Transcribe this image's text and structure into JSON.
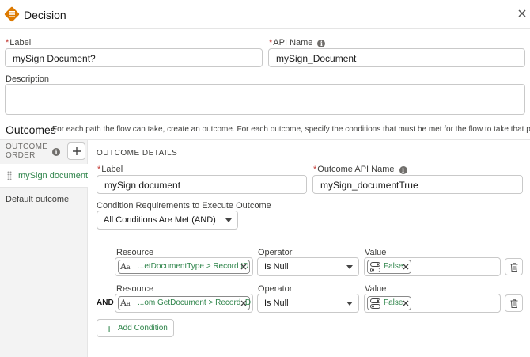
{
  "header": {
    "title": "Decision",
    "logo_icon": "decision-diamond-icon",
    "accent": "#dd7a01"
  },
  "label_field": {
    "label": "Label",
    "value": "mySign Document?"
  },
  "api_name_field": {
    "label": "API Name",
    "value": "mySign_Document"
  },
  "description_field": {
    "label": "Description",
    "value": ""
  },
  "outcomes": {
    "title": "Outcomes",
    "help": "For each path the flow can take, create an outcome. For each outcome, specify the conditions that must be met for the flow to take that path."
  },
  "sidebar": {
    "order_label": "OUTCOME ORDER",
    "items": [
      {
        "label": "mySign document",
        "active": true
      },
      {
        "label": "Default outcome",
        "active": false
      }
    ]
  },
  "details": {
    "section_title": "OUTCOME DETAILS",
    "label_field": {
      "label": "Label",
      "value": "mySign document"
    },
    "api_name_field": {
      "label": "Outcome API Name",
      "value": "mySign_documentTrue"
    },
    "condition_requirements": {
      "label": "Condition Requirements to Execute Outcome",
      "value": "All Conditions Are Met (AND)"
    },
    "conditions": [
      {
        "connector": "",
        "resource_label": "Resource",
        "resource": "...etDocumentType > Record ID",
        "operator_label": "Operator",
        "operator": "Is Null",
        "value_label": "Value",
        "value": "False"
      },
      {
        "connector": "AND",
        "resource_label": "Resource",
        "resource": "...om GetDocument > Record ID",
        "operator_label": "Operator",
        "operator": "Is Null",
        "value_label": "Value",
        "value": "False"
      }
    ],
    "add_condition": "Add Condition"
  },
  "colors": {
    "green": "#2e844a",
    "required": "#c23934"
  }
}
